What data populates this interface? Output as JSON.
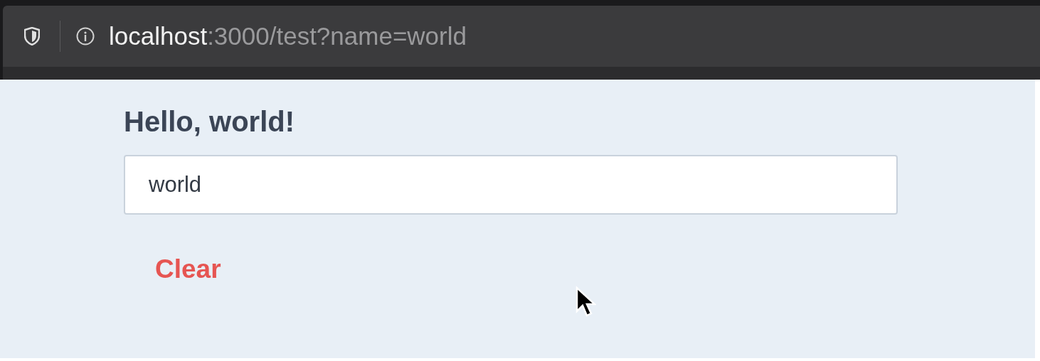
{
  "address_bar": {
    "host": "localhost",
    "path": ":3000/test?name=world"
  },
  "heading": "Hello, world!",
  "name_field": {
    "value": "world"
  },
  "clear_button": {
    "label": "Clear"
  }
}
